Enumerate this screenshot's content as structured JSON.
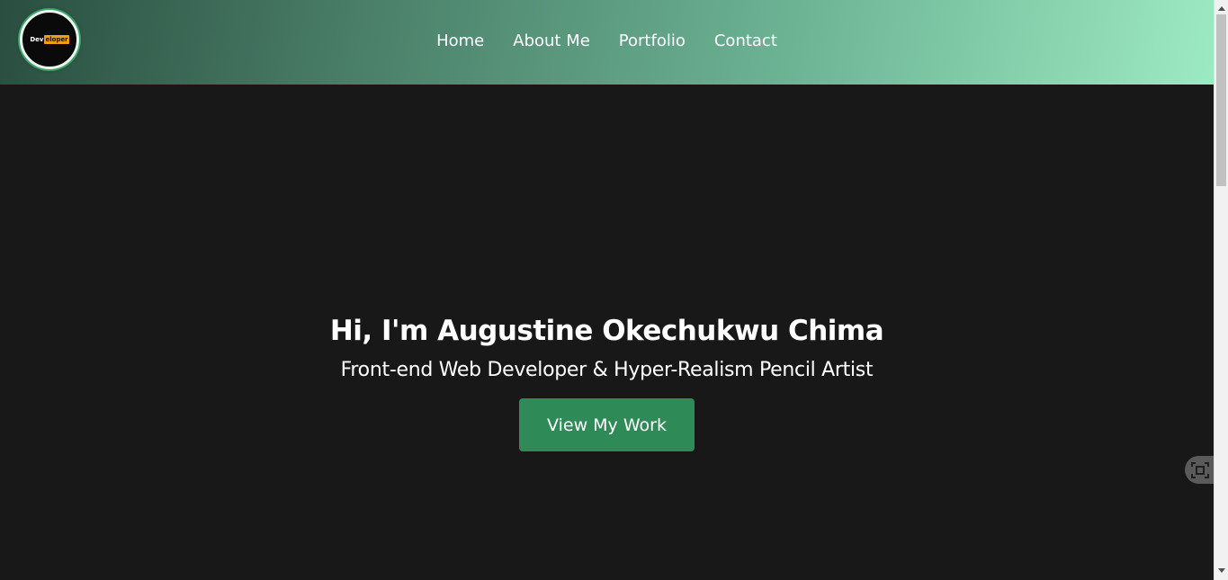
{
  "header": {
    "logo": {
      "text_part1": "Dev",
      "text_part2": "eloper",
      "highlight_color": "#f29b14"
    },
    "nav": [
      {
        "label": "Home"
      },
      {
        "label": "About Me"
      },
      {
        "label": "Portfolio"
      },
      {
        "label": "Contact"
      }
    ]
  },
  "hero": {
    "heading": "Hi, I'm Augustine Okechukwu Chima",
    "subheading": "Front-end Web Developer & Hyper-Realism Pencil Artist",
    "cta_label": "View My Work",
    "cta_color": "#2e8b57"
  },
  "colors": {
    "background": "#181818",
    "header_gradient_start": "#2a4e40",
    "header_gradient_end": "#9ceac4"
  },
  "icons": {
    "floating_button": "screenshot-capture-icon",
    "scroll_up": "triangle-up-icon",
    "scroll_down": "triangle-down-icon"
  }
}
